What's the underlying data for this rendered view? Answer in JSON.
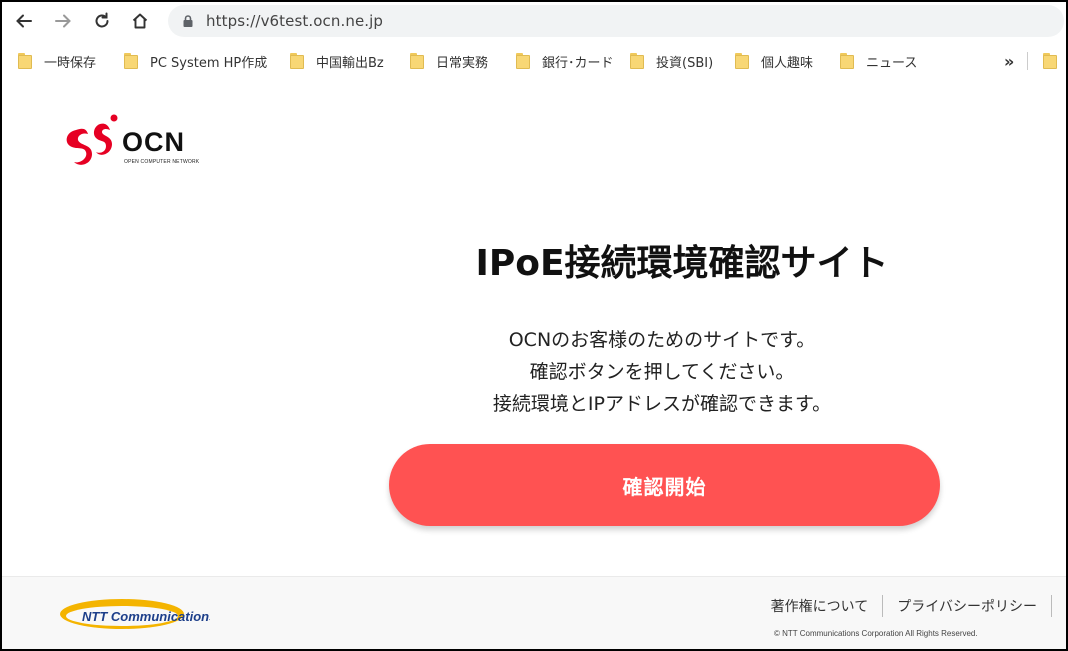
{
  "browser": {
    "url": "https://v6test.ocn.ne.jp"
  },
  "bookmarks": {
    "items": [
      {
        "label": "一時保存"
      },
      {
        "label": "PC System HP作成"
      },
      {
        "label": "中国輸出Bz"
      },
      {
        "label": "日常実務"
      },
      {
        "label": "銀行･カード"
      },
      {
        "label": "投資(SBI)"
      },
      {
        "label": "個人趣味"
      },
      {
        "label": "ニュース"
      }
    ],
    "overflow": "»"
  },
  "brand": {
    "name": "OCN",
    "tagline": "OPEN COMPUTER NETWORK",
    "logo_red": "#e60023"
  },
  "main": {
    "title": "IPoE接続環境確認サイト",
    "lines": [
      "OCNのお客様のためのサイトです。",
      "確認ボタンを押してください。",
      "接続環境とIPアドレスが確認できます。"
    ],
    "button_label": "確認開始",
    "button_color": "#ff5252"
  },
  "footer": {
    "ntt_brand": "NTT Communications",
    "links": [
      "著作権について",
      "プライバシーポリシー"
    ],
    "copyright": "© NTT Communications Corporation All Rights Reserved."
  }
}
